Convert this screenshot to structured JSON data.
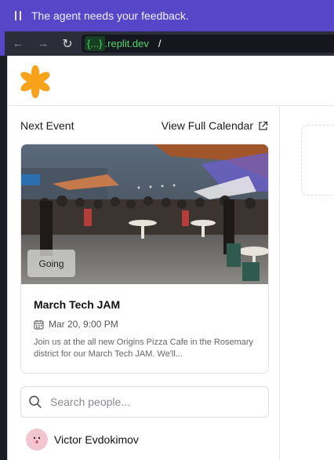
{
  "banner": {
    "text": "The agent needs your feedback.",
    "icon": "pause-icon"
  },
  "browser": {
    "domain_chip": "{...}",
    "domain_rest": ".replit.dev",
    "path": "/",
    "icons": [
      "back-arrow-icon",
      "forward-arrow-icon",
      "reload-icon"
    ]
  },
  "colors": {
    "banner": "#5747c8",
    "accent_logo": "#f7a21b",
    "url_green": "#52d66a"
  },
  "next_event": {
    "heading": "Next Event",
    "calendar_link": "View Full Calendar",
    "status_badge": "Going",
    "title": "March Tech JAM",
    "date": "Mar 20, 9:00 PM",
    "description": "Join us at the all new Origins Pizza Cafe in the Rosemary district for our March Tech JAM. We'll..."
  },
  "search": {
    "placeholder": "Search people..."
  },
  "people": [
    {
      "name": "Victor Evdokimov"
    }
  ]
}
